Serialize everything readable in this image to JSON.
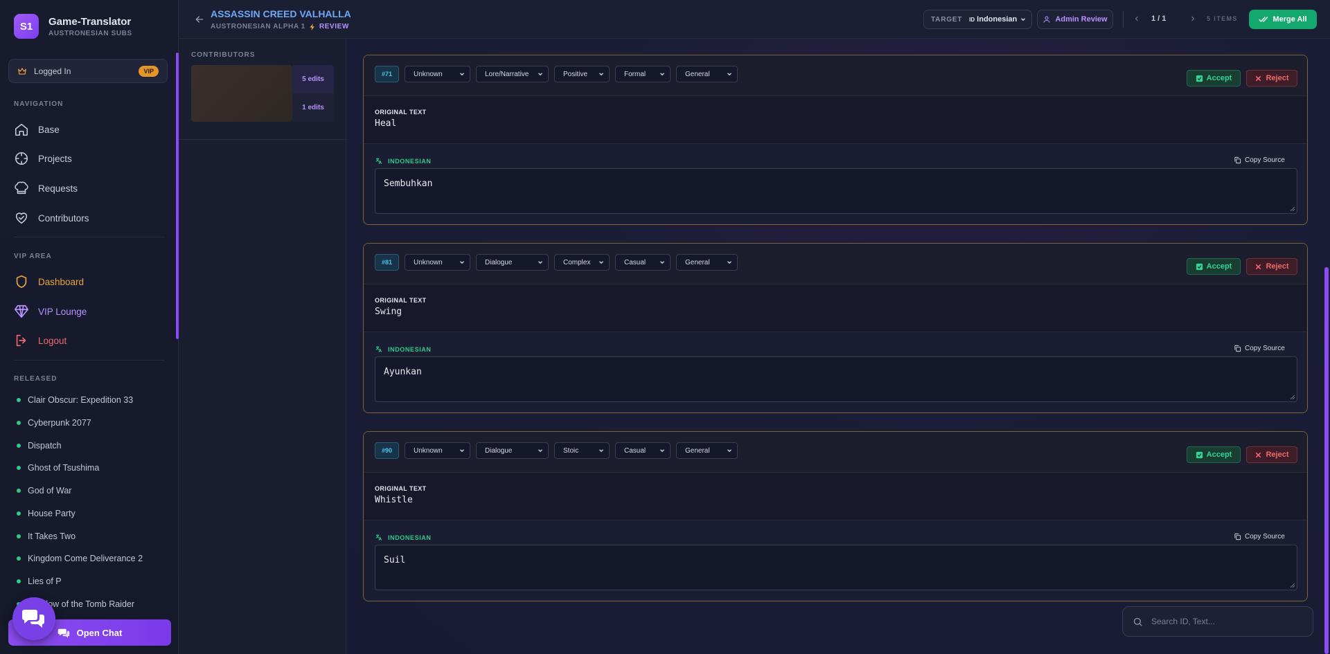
{
  "brand": {
    "logo": "S1",
    "title": "Game-Translator",
    "subtitle": "AUSTRONESIAN SUBS"
  },
  "user": {
    "status": "Logged In",
    "badge": "VIP"
  },
  "nav": {
    "label": "NAVIGATION",
    "items": [
      {
        "label": "Base",
        "icon": "home-icon"
      },
      {
        "label": "Projects",
        "icon": "crosshair-icon"
      },
      {
        "label": "Requests",
        "icon": "chef-hat-icon"
      },
      {
        "label": "Contributors",
        "icon": "heart-handshake-icon"
      }
    ]
  },
  "vip": {
    "label": "VIP AREA",
    "items": [
      {
        "label": "Dashboard",
        "icon": "shield-icon"
      },
      {
        "label": "VIP Lounge",
        "icon": "gem-icon"
      },
      {
        "label": "Logout",
        "icon": "logout-icon"
      }
    ]
  },
  "released": {
    "label": "RELEASED",
    "items": [
      "Clair Obscur: Expedition 33",
      "Cyberpunk 2077",
      "Dispatch",
      "Ghost of Tsushima",
      "God of War",
      "House Party",
      "It Takes Two",
      "Kingdom Come Deliverance 2",
      "Lies of P",
      "Shadow of the Tomb Raider"
    ]
  },
  "chat": {
    "label": "Open Chat"
  },
  "header": {
    "title": "ASSASSIN CREED VALHALLA",
    "team": "AUSTRONESIAN ALPHA 1",
    "mode": "REVIEW",
    "target_label": "TARGET",
    "target_flag": "ID",
    "target_value": "Indonesian",
    "admin_label": "Admin Review",
    "page": "1 / 1",
    "items_count": "5 ITEMS",
    "merge_label": "Merge All"
  },
  "contributors": {
    "title": "CONTRIBUTORS",
    "entries": [
      {
        "edits": "5 edits"
      },
      {
        "edits": "1 edits"
      }
    ]
  },
  "labels": {
    "original": "ORIGINAL TEXT",
    "language": "INDONESIAN",
    "copy_source": "Copy Source",
    "accept": "Accept",
    "reject": "Reject"
  },
  "cards": [
    {
      "id": "#71",
      "speaker": "Unknown",
      "category": "Lore/Narrative",
      "tone": "Positive",
      "register": "Formal",
      "scope": "General",
      "original": "Heal",
      "translation": "Sembuhkan"
    },
    {
      "id": "#81",
      "speaker": "Unknown",
      "category": "Dialogue",
      "tone": "Complex",
      "register": "Casual",
      "scope": "General",
      "original": "Swing",
      "translation": "Ayunkan"
    },
    {
      "id": "#90",
      "speaker": "Unknown",
      "category": "Dialogue",
      "tone": "Stoic",
      "register": "Casual",
      "scope": "General",
      "original": "Whistle",
      "translation": "Suil"
    }
  ],
  "search": {
    "placeholder": "Search ID, Text..."
  },
  "colors": {
    "accent": "#8b4cf2",
    "gold": "#e9a53b",
    "success": "#14a86f",
    "danger": "#f06a6a",
    "info": "#6fa8f4"
  }
}
